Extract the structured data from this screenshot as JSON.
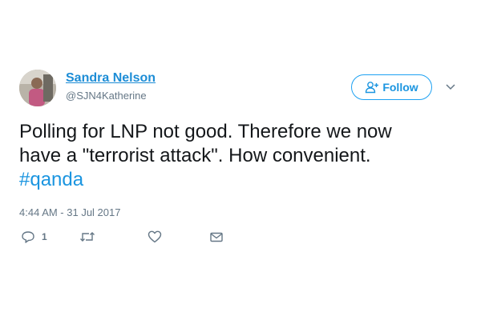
{
  "tweet": {
    "author": {
      "name": "Sandra Nelson",
      "handle": "@SJN4Katherine"
    },
    "follow_label": "Follow",
    "text_lines": [
      "Polling for LNP not good. Therefore we now",
      "have a \"terrorist attack\". How convenient."
    ],
    "hashtag": "#qanda",
    "timestamp": "4:44 AM - 31 Jul 2017",
    "actions": {
      "reply_count": "1"
    }
  },
  "colors": {
    "link_blue": "#1b95e0",
    "text": "#14171a",
    "secondary": "#657786"
  },
  "icons": [
    "person-plus-icon",
    "chevron-down-icon",
    "reply-icon",
    "retweet-icon",
    "heart-icon",
    "envelope-icon"
  ]
}
